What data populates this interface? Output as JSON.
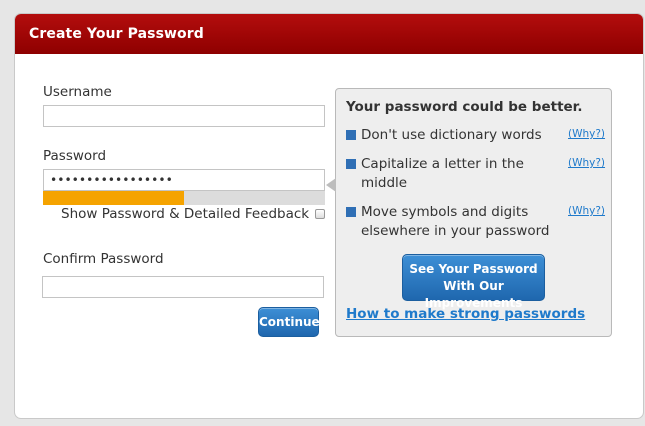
{
  "header": {
    "title": "Create Your Password"
  },
  "form": {
    "username_label": "Username",
    "username_value": "",
    "password_label": "Password",
    "password_value": "•••••••••••••••••",
    "strength_fraction": 0.5,
    "show_password_label": "Show Password & Detailed Feedback",
    "confirm_label": "Confirm Password",
    "confirm_value": "",
    "continue_label": "Continue"
  },
  "feedback": {
    "title": "Your password could be better.",
    "tips": [
      {
        "text": "Don't use dictionary words",
        "why": "(Why?)"
      },
      {
        "text": "Capitalize a letter in the middle",
        "why": "(Why?)"
      },
      {
        "text": "Move symbols and digits elsewhere in your password",
        "why": "(Why?)"
      }
    ],
    "improve_button": "See Your Password With Our Improvements",
    "help_link": "How to make strong passwords"
  },
  "colors": {
    "header": "#9b0606",
    "strength": "#f5a300",
    "accent_blue": "#2a7bc4",
    "bullet": "#2f6fb5"
  }
}
